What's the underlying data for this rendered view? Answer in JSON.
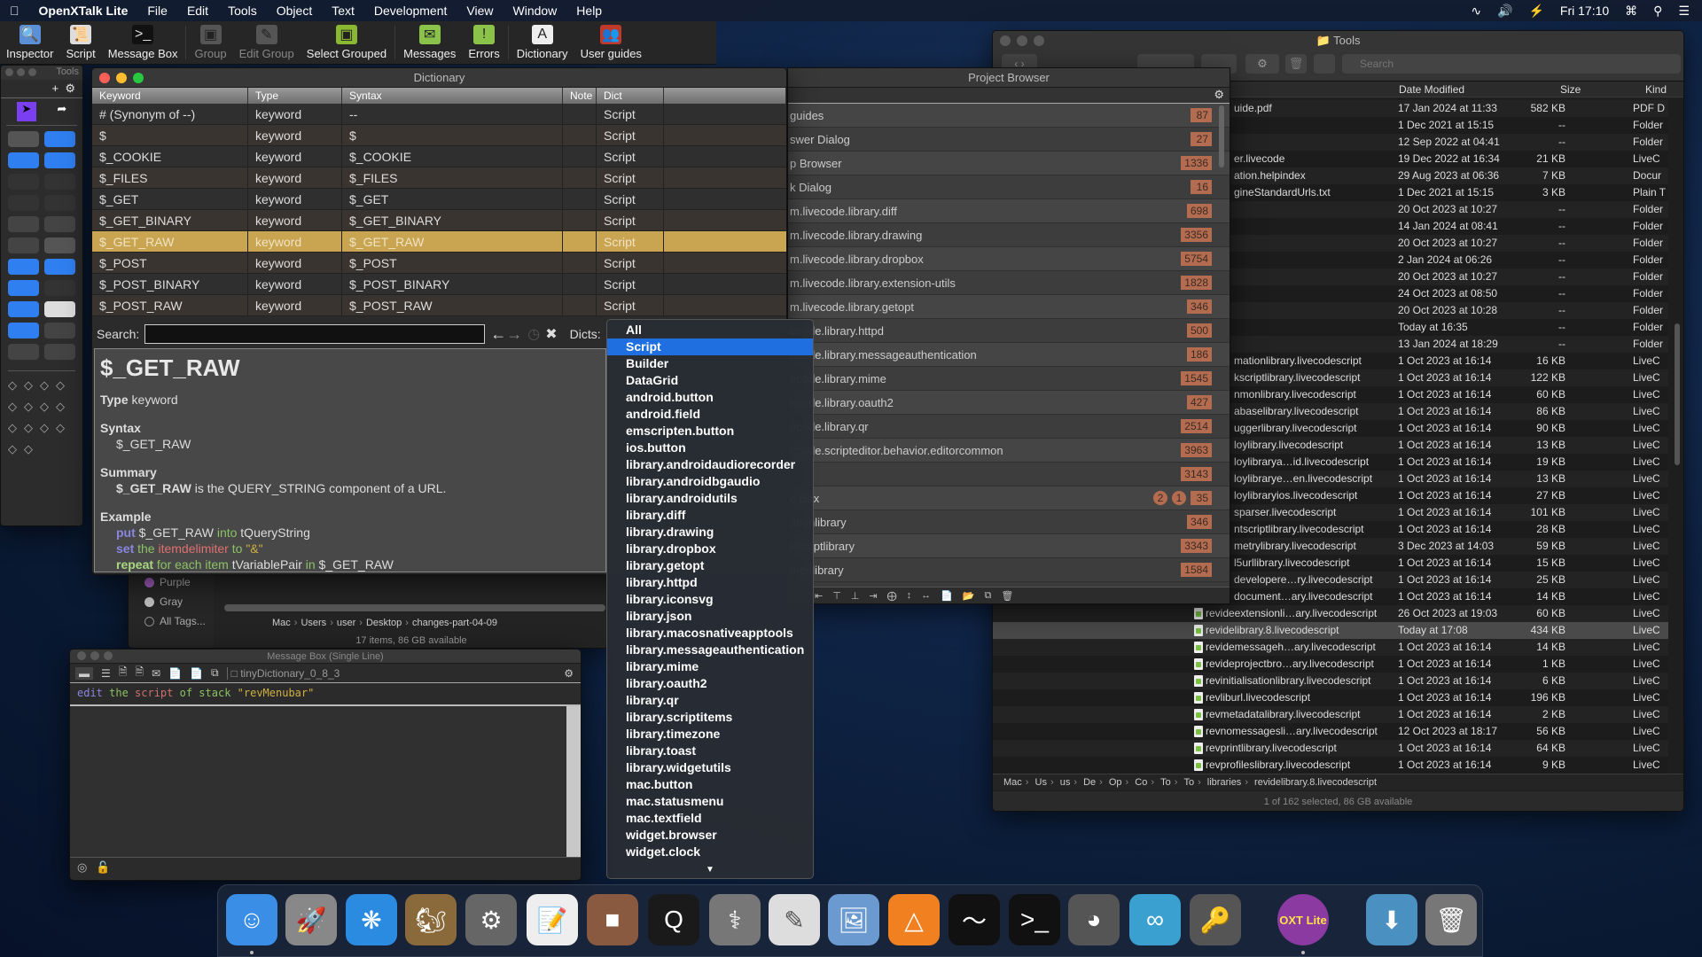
{
  "menubar": {
    "apple": "",
    "app": "OpenXTalk Lite",
    "items": [
      "File",
      "Edit",
      "Tools",
      "Object",
      "Text",
      "Development",
      "View",
      "Window",
      "Help"
    ],
    "clock": "Fri 17:10",
    "status_icons": [
      "wifi-icon",
      "volume-icon",
      "battery-charging-icon",
      "input-menu-icon",
      "spotlight-search-icon",
      "notification-center-icon"
    ]
  },
  "toolbar": {
    "items": [
      {
        "label": "Inspector",
        "icon": "inspector-icon",
        "enabled": true
      },
      {
        "label": "Script",
        "icon": "script-scroll-icon",
        "enabled": true
      },
      {
        "label": "Message Box",
        "icon": "terminal-icon",
        "enabled": true
      },
      {
        "label": "Group",
        "icon": "group-icon",
        "enabled": false
      },
      {
        "label": "Edit Group",
        "icon": "edit-group-icon",
        "enabled": false
      },
      {
        "label": "Select Grouped",
        "icon": "select-grouped-icon",
        "enabled": true
      },
      {
        "label": "Messages",
        "icon": "envelope-icon",
        "enabled": true
      },
      {
        "label": "Errors",
        "icon": "warning-icon",
        "enabled": true
      },
      {
        "label": "Dictionary",
        "icon": "dictionary-icon",
        "enabled": true
      },
      {
        "label": "User guides",
        "icon": "users-icon",
        "enabled": true
      }
    ]
  },
  "tools_palette": {
    "title": "Tools"
  },
  "dictionary": {
    "title": "Dictionary",
    "columns": [
      "Keyword",
      "Type",
      "Syntax",
      "Note",
      "Dict"
    ],
    "rows": [
      [
        "# (Synonym of --)",
        "keyword",
        "--",
        "",
        "Script"
      ],
      [
        "$",
        "keyword",
        "$",
        "",
        "Script"
      ],
      [
        "$_COOKIE",
        "keyword",
        "$_COOKIE",
        "",
        "Script"
      ],
      [
        "$_FILES",
        "keyword",
        "$_FILES",
        "",
        "Script"
      ],
      [
        "$_GET",
        "keyword",
        "$_GET",
        "",
        "Script"
      ],
      [
        "$_GET_BINARY",
        "keyword",
        "$_GET_BINARY",
        "",
        "Script"
      ],
      [
        "$_GET_RAW",
        "keyword",
        "$_GET_RAW",
        "",
        "Script"
      ],
      [
        "$_POST",
        "keyword",
        "$_POST",
        "",
        "Script"
      ],
      [
        "$_POST_BINARY",
        "keyword",
        "$_POST_BINARY",
        "",
        "Script"
      ],
      [
        "$_POST_RAW",
        "keyword",
        "$_POST_RAW",
        "",
        "Script"
      ]
    ],
    "selected_row": 6,
    "selection_color": "#c9a551",
    "search_label": "Search:",
    "search_value": "",
    "dicts_label": "Dicts:",
    "detail": {
      "title": "$_GET_RAW",
      "type_label": "Type",
      "type_value": "keyword",
      "syntax_label": "Syntax",
      "syntax_value": "$_GET_RAW",
      "summary_label": "Summary",
      "summary_term": "$_GET_RAW",
      "summary_rest": " is the QUERY_STRING component of a URL.",
      "example_label": "Example",
      "example": {
        "l1": [
          "put",
          " $_GET_RAW ",
          "into",
          " tQueryString"
        ],
        "l2": [
          "set",
          " the ",
          "itemdelimiter",
          " to ",
          "\"&\""
        ],
        "l3": [
          "repeat",
          " for each item",
          " tVariablePair ",
          "in",
          " $_GET_RAW"
        ]
      }
    }
  },
  "dicts_dropdown": {
    "selected": "Script",
    "options": [
      "All",
      "Script",
      "Builder",
      "DataGrid",
      "android.button",
      "android.field",
      "emscripten.button",
      "ios.button",
      "library.androidaudiorecorder",
      "library.androidbgaudio",
      "library.androidutils",
      "library.diff",
      "library.drawing",
      "library.dropbox",
      "library.getopt",
      "library.httpd",
      "library.iconsvg",
      "library.json",
      "library.macosnativeapptools",
      "library.messageauthentication",
      "library.mime",
      "library.oauth2",
      "library.qr",
      "library.scriptitems",
      "library.timezone",
      "library.toast",
      "library.widgetutils",
      "mac.button",
      "mac.statusmenu",
      "mac.textfield",
      "widget.browser",
      "widget.clock"
    ],
    "highlight_color": "#1f6fe0"
  },
  "project_browser": {
    "title": "Project Browser",
    "badge_color": "#b46c50",
    "rows": [
      {
        "name": "guides",
        "count": "87"
      },
      {
        "name": "swer Dialog",
        "count": "27"
      },
      {
        "name": "p Browser",
        "count": "1336"
      },
      {
        "name": "k Dialog",
        "count": "16"
      },
      {
        "name": "m.livecode.library.diff",
        "count": "698"
      },
      {
        "name": "m.livecode.library.drawing",
        "count": "3356"
      },
      {
        "name": "m.livecode.library.dropbox",
        "count": "5754"
      },
      {
        "name": "m.livecode.library.extension-utils",
        "count": "1828"
      },
      {
        "name": "m.livecode.library.getopt",
        "count": "346"
      },
      {
        "name": "ecode.library.httpd",
        "count": "500"
      },
      {
        "name": "ecode.library.messageauthentication",
        "count": "186"
      },
      {
        "name": "ecode.library.mime",
        "count": "1545"
      },
      {
        "name": "ecode.library.oauth2",
        "count": "427"
      },
      {
        "name": "ecode.library.qr",
        "count": "2514"
      },
      {
        "name": "ecode.scripteditor.behavior.editorcommon",
        "count": "3963"
      },
      {
        "name": "",
        "count": "3143"
      },
      {
        "name": "e Box",
        "count": "35",
        "extra": [
          "2",
          "1"
        ]
      },
      {
        "name": "ationlibrary",
        "count": "346"
      },
      {
        "name": "kscriptlibrary",
        "count": "3343"
      },
      {
        "name": "monlibrary",
        "count": "1584"
      }
    ]
  },
  "finder": {
    "title": "Tools",
    "search_placeholder": "Search",
    "columns": {
      "date": "Date Modified",
      "size": "Size",
      "kind": "Kind"
    },
    "rows": [
      {
        "name": "uide.pdf",
        "date": "17 Jan 2024 at 11:33",
        "size": "582 KB",
        "kind": "PDF D"
      },
      {
        "name": "",
        "date": "1 Dec 2021 at 15:15",
        "size": "--",
        "kind": "Folder"
      },
      {
        "name": "",
        "date": "12 Sep 2022 at 04:41",
        "size": "--",
        "kind": "Folder"
      },
      {
        "name": "er.livecode",
        "date": "19 Dec 2022 at 16:34",
        "size": "21 KB",
        "kind": "LiveC"
      },
      {
        "name": "ation.helpindex",
        "date": "29 Aug 2023 at 06:36",
        "size": "7 KB",
        "kind": "Docur"
      },
      {
        "name": "gineStandardUrls.txt",
        "date": "1 Dec 2021 at 15:15",
        "size": "3 KB",
        "kind": "Plain T"
      },
      {
        "name": "",
        "date": "20 Oct 2023 at 10:27",
        "size": "--",
        "kind": "Folder"
      },
      {
        "name": "",
        "date": "14 Jan 2024 at 08:41",
        "size": "--",
        "kind": "Folder"
      },
      {
        "name": "",
        "date": "20 Oct 2023 at 10:27",
        "size": "--",
        "kind": "Folder"
      },
      {
        "name": "",
        "date": "2 Jan 2024 at 06:26",
        "size": "--",
        "kind": "Folder"
      },
      {
        "name": "",
        "date": "20 Oct 2023 at 10:27",
        "size": "--",
        "kind": "Folder"
      },
      {
        "name": "",
        "date": "24 Oct 2023 at 08:50",
        "size": "--",
        "kind": "Folder"
      },
      {
        "name": "",
        "date": "20 Oct 2023 at 10:28",
        "size": "--",
        "kind": "Folder"
      },
      {
        "name": "",
        "date": "Today at 16:35",
        "size": "--",
        "kind": "Folder"
      },
      {
        "name": "",
        "date": "13 Jan 2024 at 18:29",
        "size": "--",
        "kind": "Folder"
      },
      {
        "name": "mationlibrary.livecodescript",
        "date": "1 Oct 2023 at 16:14",
        "size": "16 KB",
        "kind": "LiveC"
      },
      {
        "name": "kscriptlibrary.livecodescript",
        "date": "1 Oct 2023 at 16:14",
        "size": "122 KB",
        "kind": "LiveC"
      },
      {
        "name": "nmonlibrary.livecodescript",
        "date": "1 Oct 2023 at 16:14",
        "size": "60 KB",
        "kind": "LiveC"
      },
      {
        "name": "abaselibrary.livecodescript",
        "date": "1 Oct 2023 at 16:14",
        "size": "86 KB",
        "kind": "LiveC"
      },
      {
        "name": "uggerlibrary.livecodescript",
        "date": "1 Oct 2023 at 16:14",
        "size": "90 KB",
        "kind": "LiveC"
      },
      {
        "name": "loylibrary.livecodescript",
        "date": "1 Oct 2023 at 16:14",
        "size": "13 KB",
        "kind": "LiveC"
      },
      {
        "name": "loylibrarya…id.livecodescript",
        "date": "1 Oct 2023 at 16:14",
        "size": "19 KB",
        "kind": "LiveC"
      },
      {
        "name": "loylibrarye…en.livecodescript",
        "date": "1 Oct 2023 at 16:14",
        "size": "13 KB",
        "kind": "LiveC"
      },
      {
        "name": "loylibraryios.livecodescript",
        "date": "1 Oct 2023 at 16:14",
        "size": "27 KB",
        "kind": "LiveC"
      },
      {
        "name": "sparser.livecodescript",
        "date": "1 Oct 2023 at 16:14",
        "size": "101 KB",
        "kind": "LiveC"
      },
      {
        "name": "ntscriptlibrary.livecodescript",
        "date": "1 Oct 2023 at 16:14",
        "size": "28 KB",
        "kind": "LiveC"
      },
      {
        "name": "metrylibrary.livecodescript",
        "date": "3 Dec 2023 at 14:03",
        "size": "59 KB",
        "kind": "LiveC"
      },
      {
        "name": "l5urllibrary.livecodescript",
        "date": "1 Oct 2023 at 16:14",
        "size": "15 KB",
        "kind": "LiveC"
      },
      {
        "name": "developere…ry.livecodescript",
        "date": "1 Oct 2023 at 16:14",
        "size": "25 KB",
        "kind": "LiveC"
      },
      {
        "name": "document…ary.livecodescript",
        "date": "1 Oct 2023 at 16:14",
        "size": "14 KB",
        "kind": "LiveC"
      },
      {
        "name": "revideextensionli…ary.livecodescript",
        "date": "26 Oct 2023 at 19:03",
        "size": "60 KB",
        "kind": "LiveC",
        "icon": true
      },
      {
        "name": "revidelibrary.8.livecodescript",
        "date": "Today at 17:08",
        "size": "434 KB",
        "kind": "LiveC",
        "icon": true,
        "selected": true
      },
      {
        "name": "revidemessageh…ary.livecodescript",
        "date": "1 Oct 2023 at 16:14",
        "size": "14 KB",
        "kind": "LiveC",
        "icon": true
      },
      {
        "name": "revideprojectbro…ary.livecodescript",
        "date": "1 Oct 2023 at 16:14",
        "size": "1 KB",
        "kind": "LiveC",
        "icon": true
      },
      {
        "name": "revinitialisationlibrary.livecodescript",
        "date": "1 Oct 2023 at 16:14",
        "size": "6 KB",
        "kind": "LiveC",
        "icon": true
      },
      {
        "name": "revliburl.livecodescript",
        "date": "1 Oct 2023 at 16:14",
        "size": "196 KB",
        "kind": "LiveC",
        "icon": true
      },
      {
        "name": "revmetadatalibrary.livecodescript",
        "date": "1 Oct 2023 at 16:14",
        "size": "2 KB",
        "kind": "LiveC",
        "icon": true
      },
      {
        "name": "revnomessagesli…ary.livecodescript",
        "date": "12 Oct 2023 at 18:17",
        "size": "56 KB",
        "kind": "LiveC",
        "icon": true
      },
      {
        "name": "revprintlibrary.livecodescript",
        "date": "1 Oct 2023 at 16:14",
        "size": "64 KB",
        "kind": "LiveC",
        "icon": true
      },
      {
        "name": "revprofileslibrary.livecodescript",
        "date": "1 Oct 2023 at 16:14",
        "size": "9 KB",
        "kind": "LiveC",
        "icon": true
      }
    ],
    "path": [
      "Mac",
      "Us",
      "us",
      "De",
      "Op",
      "Co",
      "To",
      "To",
      "libraries",
      "revidelibrary.8.livecodescript"
    ],
    "status": "1 of 162 selected, 86 GB available"
  },
  "finder_back": {
    "tags": [
      {
        "label": "Purple",
        "color": "#9b59b6"
      },
      {
        "label": "Gray",
        "color": "#bbbbbb"
      },
      {
        "label": "All Tags...",
        "color": ""
      }
    ],
    "path": [
      "Mac",
      "Users",
      "user",
      "Desktop",
      "changes-part-04-09"
    ],
    "status": "17 items, 86 GB available"
  },
  "message_box": {
    "title": "Message Box (Single Line)",
    "stack": "tinyDictionary_0_8_3",
    "command_tokens": [
      "edit",
      " the",
      " script",
      " of",
      " stack",
      " \"revMenubar\""
    ]
  },
  "dock": {
    "apps": [
      "finder-icon",
      "launchpad-icon",
      "safari-icon",
      "preview-squirrel-icon",
      "system-preferences-icon",
      "textedit-icon",
      "app-icon",
      "quicktime-icon",
      "disk-utility-icon",
      "script-editor-icon",
      "preview-icon",
      "vlc-icon",
      "activity-monitor-icon",
      "terminal-icon",
      "digital-color-meter-icon",
      "app-icon-blue",
      "keychain-icon",
      "openxtalk-icon",
      "downloads-folder-icon",
      "trash-icon"
    ],
    "openxtalk_label": "OXT Lite"
  }
}
